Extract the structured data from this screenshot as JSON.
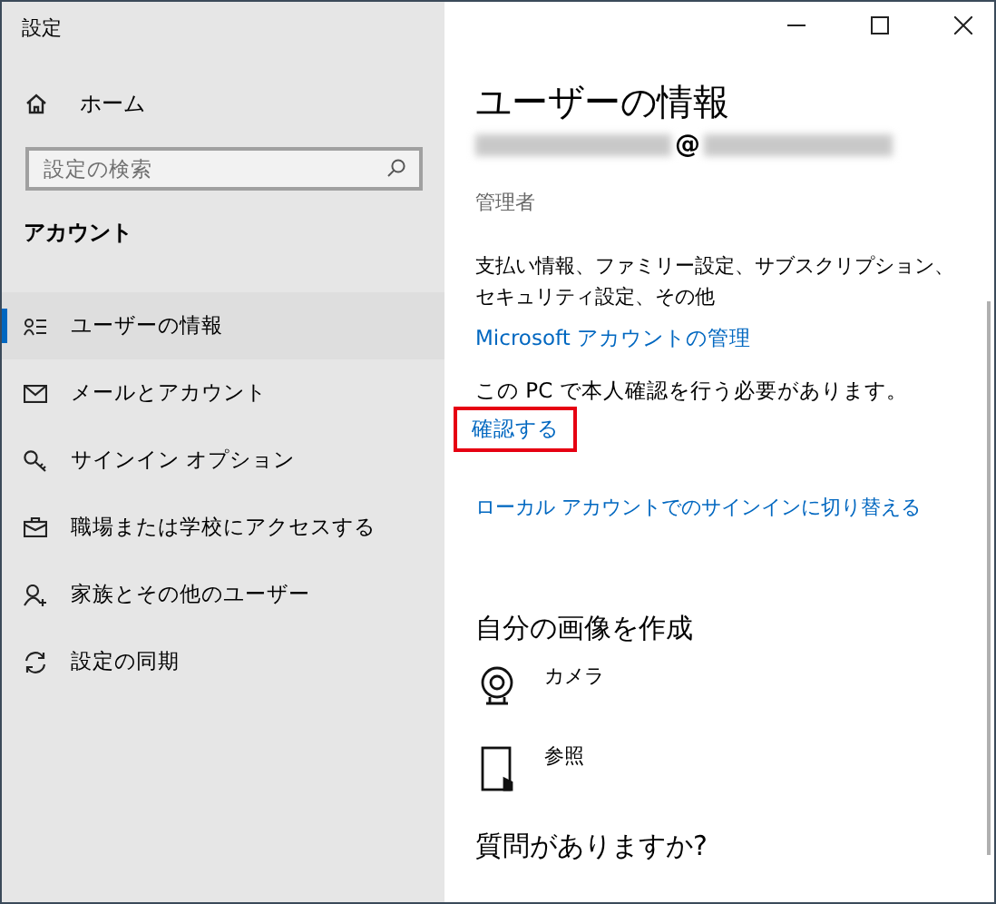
{
  "window": {
    "title": "設定"
  },
  "sidebar": {
    "home": "ホーム",
    "search": {
      "placeholder": "設定の検索"
    },
    "section": "アカウント",
    "items": [
      {
        "label": "ユーザーの情報",
        "selected": true
      },
      {
        "label": "メールとアカウント",
        "selected": false
      },
      {
        "label": "サインイン オプション",
        "selected": false
      },
      {
        "label": "職場または学校にアクセスする",
        "selected": false
      },
      {
        "label": "家族とその他のユーザー",
        "selected": false
      },
      {
        "label": "設定の同期",
        "selected": false
      }
    ]
  },
  "main": {
    "title": "ユーザーの情報",
    "email_at": "@",
    "role": "管理者",
    "description": "支払い情報、ファミリー設定、サブスクリプション、セキュリティ設定、その他",
    "manage_link": {
      "label": "Microsoft アカウントの管理",
      "highlighted": false
    },
    "verify_text": "この PC で本人確認を行う必要があります。",
    "verify_link": {
      "label": "確認する",
      "highlighted": true
    },
    "local_link": {
      "label": "ローカル アカウントでのサインインに切り替える",
      "highlighted": false
    },
    "picture_heading": "自分の画像を作成",
    "picture_options": [
      {
        "label": "カメラ"
      },
      {
        "label": "参照"
      }
    ],
    "question_heading": "質問がありますか?"
  }
}
